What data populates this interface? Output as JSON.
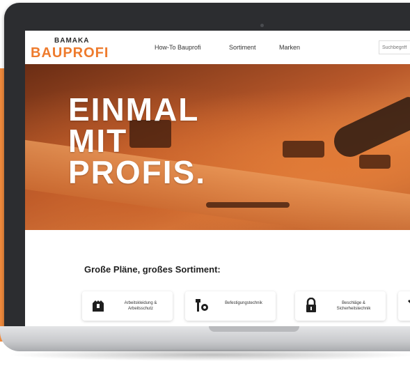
{
  "brand": {
    "top": "BAMAKA",
    "name": "BAUPROFI"
  },
  "nav": {
    "items": [
      "How-To Bauprofi",
      "Sortiment",
      "Marken"
    ]
  },
  "search": {
    "placeholder": "Suchbegriff"
  },
  "hero": {
    "headline_lines": [
      "EINMAL",
      "MIT",
      "PROFIS."
    ]
  },
  "section": {
    "title": "Große Pläne, großes Sortiment:"
  },
  "categories": [
    {
      "label": "Arbeitskleidung & Arbeitsschutz",
      "icon": "workwear-icon"
    },
    {
      "label": "Befestigungstechnik",
      "icon": "fastener-icon"
    },
    {
      "label": "Beschläge & Sicherheitstechnik",
      "icon": "padlock-icon"
    },
    {
      "label": "",
      "icon": "tools-icon"
    }
  ],
  "colors": {
    "brand_orange": "#ee7b2d",
    "laptop_frame": "#2c2d30"
  }
}
